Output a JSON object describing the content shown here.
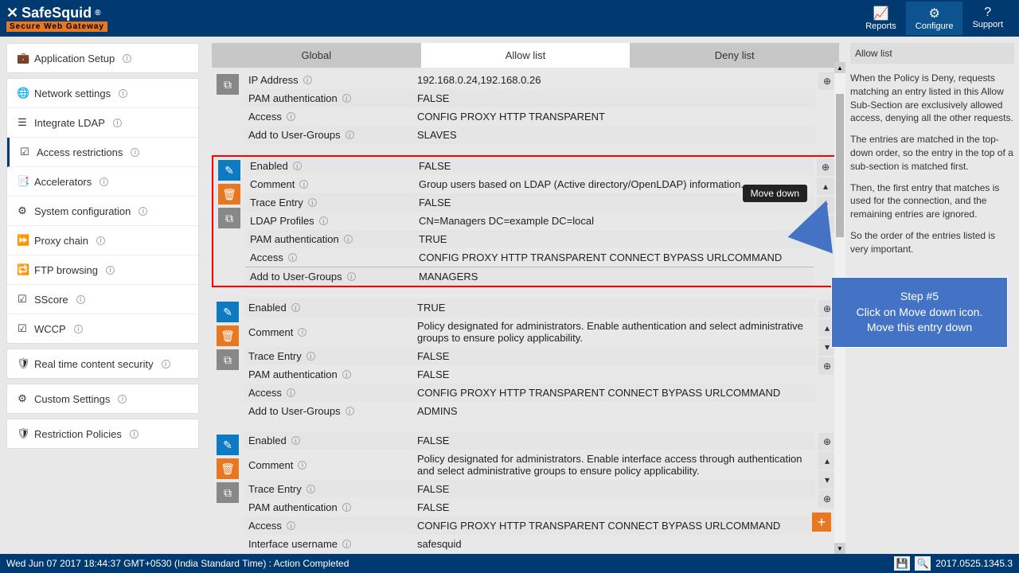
{
  "header": {
    "brand": "SafeSquid",
    "brand_suffix": "®",
    "tagline": "Secure Web Gateway",
    "reports": "Reports",
    "configure": "Configure",
    "support": "Support"
  },
  "sidebar": {
    "items": [
      {
        "icon": "💼",
        "label": "Application Setup"
      },
      {
        "icon": "🌐",
        "label": "Network settings"
      },
      {
        "icon": "☰",
        "label": "Integrate LDAP"
      },
      {
        "icon": "☑",
        "label": "Access restrictions"
      },
      {
        "icon": "📑",
        "label": "Accelerators"
      },
      {
        "icon": "⚙",
        "label": "System configuration"
      },
      {
        "icon": "⏩",
        "label": "Proxy chain"
      },
      {
        "icon": "🔁",
        "label": "FTP browsing"
      },
      {
        "icon": "☑",
        "label": "SScore"
      },
      {
        "icon": "☑",
        "label": "WCCP"
      },
      {
        "icon": "🛡",
        "label": "Real time content security"
      },
      {
        "icon": "⚙",
        "label": "Custom Settings"
      },
      {
        "icon": "🛡",
        "label": "Restriction Policies"
      }
    ]
  },
  "tabs": {
    "global": "Global",
    "allow": "Allow list",
    "deny": "Deny list"
  },
  "labels": {
    "enabled": "Enabled",
    "comment": "Comment",
    "trace": "Trace Entry",
    "ldap_profiles": "LDAP Profiles",
    "pam": "PAM authentication",
    "access": "Access",
    "groups": "Add to User-Groups",
    "ip": "IP Address",
    "iface_user": "Interface username"
  },
  "entries": {
    "e0": {
      "ip": "192.168.0.24,192.168.0.26",
      "pam": "FALSE",
      "access": "CONFIG  PROXY  HTTP  TRANSPARENT",
      "groups": "SLAVES"
    },
    "e1": {
      "enabled": "FALSE",
      "comment": "Group users based on LDAP (Active directory/OpenLDAP) information.",
      "trace": "FALSE",
      "ldap": "CN=Managers DC=example DC=local",
      "pam": "TRUE",
      "access": "CONFIG  PROXY  HTTP  TRANSPARENT  CONNECT  BYPASS  URLCOMMAND",
      "groups": "MANAGERS"
    },
    "e2": {
      "enabled": "TRUE",
      "comment": "Policy designated for administrators. Enable authentication and select administrative groups to ensure policy applicability.",
      "trace": "FALSE",
      "pam": "FALSE",
      "access": "CONFIG  PROXY  HTTP  TRANSPARENT  CONNECT  BYPASS  URLCOMMAND",
      "groups": "ADMINS"
    },
    "e3": {
      "enabled": "FALSE",
      "comment": "Policy designated for administrators. Enable interface access through authentication and select administrative groups to ensure policy applicability.",
      "trace": "FALSE",
      "pam": "FALSE",
      "access": "CONFIG  PROXY  HTTP  TRANSPARENT  CONNECT  BYPASS  URLCOMMAND",
      "iface_user": "safesquid"
    }
  },
  "tooltip": "Move down",
  "callout": {
    "title": "Step #5",
    "line1": "Click on Move down icon.",
    "line2": "Move this entry down"
  },
  "right": {
    "title": "Allow list",
    "p1": "When the Policy is Deny, requests matching an entry listed in this Allow Sub-Section are exclusively allowed access, denying all the other requests.",
    "p2": "The entries are matched in the top-down order, so the entry in the top of a sub-section is matched first.",
    "p3": "Then, the first entry that matches is used for the connection, and the remaining entries are ignored.",
    "p4": "So the order of the entries listed is very important."
  },
  "footer": {
    "status": "Wed Jun 07 2017 18:44:37 GMT+0530 (India Standard Time) : Action Completed",
    "version": "2017.0525.1345.3"
  }
}
